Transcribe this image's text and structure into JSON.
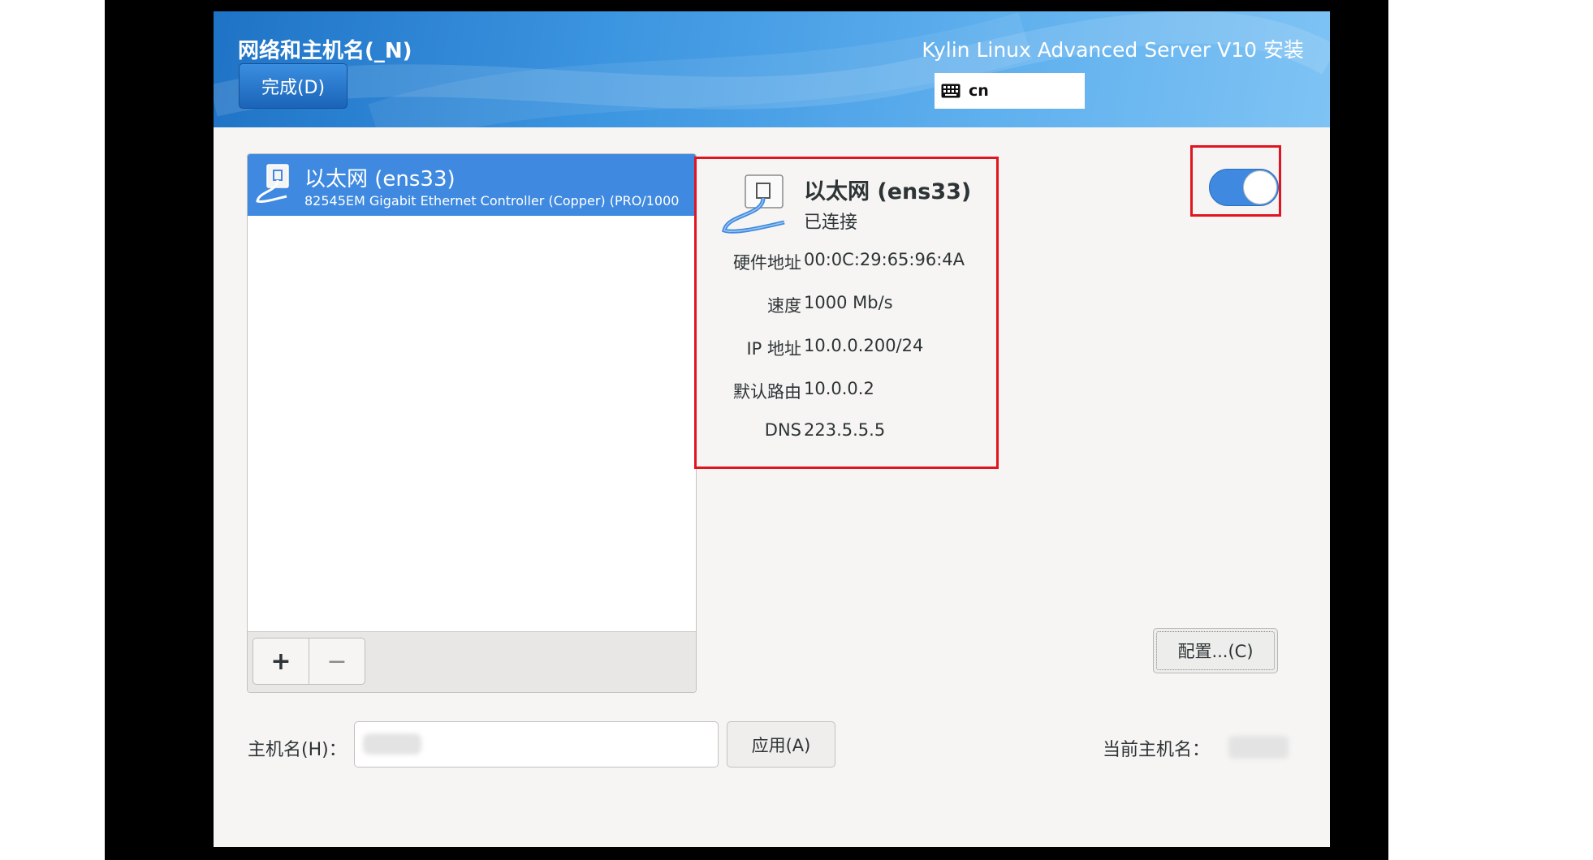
{
  "header": {
    "spoke_title": "网络和主机名(_N)",
    "done_label": "完成(D)",
    "product_title": "Kylin Linux Advanced Server V10 安装",
    "keyboard_layout": "cn",
    "keyboard_icon": "keyboard-icon"
  },
  "device_list": {
    "items": [
      {
        "name": "以太网 (ens33)",
        "description": "82545EM Gigabit Ethernet Controller (Copper) (PRO/1000",
        "icon": "ethernet-icon",
        "selected": true
      }
    ],
    "add_label": "+",
    "remove_label": "−"
  },
  "details": {
    "name": "以太网 (ens33)",
    "status": "已连接",
    "rows": [
      {
        "label": "硬件地址",
        "value": "00:0C:29:65:96:4A"
      },
      {
        "label": "速度",
        "value": "1000 Mb/s"
      },
      {
        "label": "IP 地址",
        "value": "10.0.0.200/24"
      },
      {
        "label": "默认路由",
        "value": "10.0.0.2"
      },
      {
        "label": "DNS",
        "value": "223.5.5.5"
      }
    ]
  },
  "toggle": {
    "on": true
  },
  "config_label": "配置...(C)",
  "hostname": {
    "label": "主机名(H)：",
    "apply_label": "应用(A)",
    "current_label": "当前主机名："
  },
  "colors": {
    "accent": "#3f8ae0",
    "highlight_frame": "#e0151f"
  }
}
